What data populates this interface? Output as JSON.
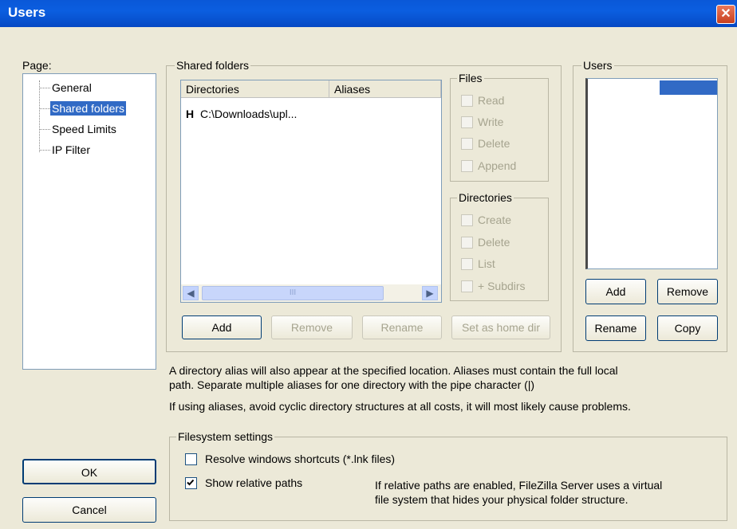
{
  "window": {
    "title": "Users",
    "close_glyph": "✕"
  },
  "page_panel": {
    "label": "Page:",
    "items": [
      {
        "label": "General",
        "selected": false
      },
      {
        "label": "Shared folders",
        "selected": true
      },
      {
        "label": "Speed Limits",
        "selected": false
      },
      {
        "label": "IP Filter",
        "selected": false
      }
    ]
  },
  "shared_folders": {
    "legend": "Shared folders",
    "columns": [
      "Directories",
      "Aliases"
    ],
    "rows": [
      {
        "marker": "H",
        "directory": "C:\\Downloads\\upl...",
        "alias": ""
      }
    ],
    "scroll_thumb_glyph": "III",
    "buttons": {
      "add": "Add",
      "remove": "Remove",
      "rename": "Rename",
      "set_home": "Set as home dir"
    }
  },
  "files_group": {
    "legend": "Files",
    "options": [
      "Read",
      "Write",
      "Delete",
      "Append"
    ]
  },
  "dirs_group": {
    "legend": "Directories",
    "options": [
      "Create",
      "Delete",
      "List",
      "+ Subdirs"
    ]
  },
  "users_group": {
    "legend": "Users",
    "buttons": {
      "add": "Add",
      "remove": "Remove",
      "rename": "Rename",
      "copy": "Copy"
    }
  },
  "info": {
    "line1": "A directory alias will also appear at the specified location. Aliases must contain the full local",
    "line2": "path. Separate multiple aliases for one directory with the pipe character (|)",
    "line3": "If using aliases, avoid cyclic directory structures at all costs, it will most likely cause problems."
  },
  "filesystem": {
    "legend": "Filesystem settings",
    "resolve_label": "Resolve windows shortcuts (*.lnk files)",
    "resolve_checked": false,
    "relative_label": "Show relative paths",
    "relative_checked": true,
    "note1": "If relative paths are enabled, FileZilla Server uses a virtual",
    "note2": "file system that hides your physical folder structure."
  },
  "dialog_buttons": {
    "ok": "OK",
    "cancel": "Cancel"
  },
  "icons": [
    "close-icon",
    "scroll-left-icon",
    "scroll-right-icon",
    "checkmark-icon"
  ]
}
